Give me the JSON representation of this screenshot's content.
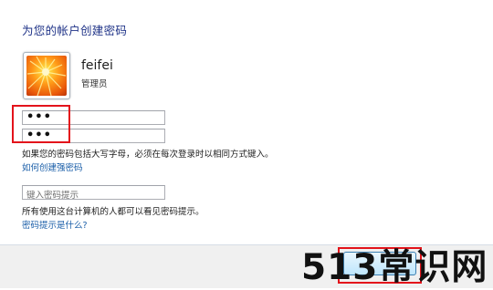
{
  "page": {
    "title": "为您的帐户创建密码"
  },
  "user": {
    "name": "feifei",
    "role": "管理员",
    "avatar_icon": "flower-avatar-icon"
  },
  "form": {
    "password_value": "•••",
    "confirm_value": "•••",
    "caps_note": "如果您的密码包括大写字母，必须在每次登录时以相同方式键入。",
    "strong_password_link": "如何创建强密码",
    "hint_placeholder": "键入密码提示",
    "hint_note": "所有使用这台计算机的人都可以看见密码提示。",
    "hint_help_link": "密码提示是什么?"
  },
  "watermark": {
    "text": "513常识网"
  },
  "colors": {
    "title": "#1e3287",
    "link": "#1a5ea8",
    "highlight_red": "#e3131b",
    "footer_bg": "#f0f0f0"
  }
}
